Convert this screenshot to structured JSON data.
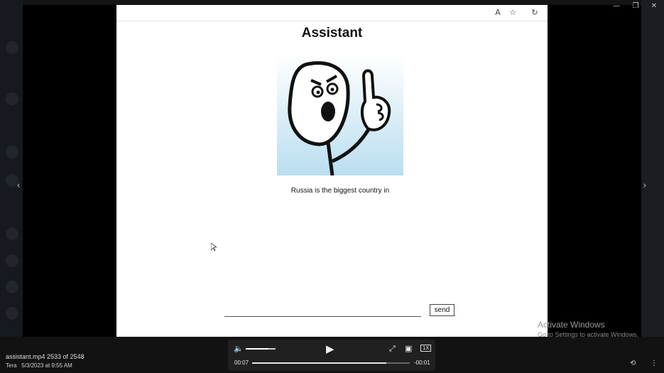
{
  "page": {
    "title": "Assistant",
    "message": "Russia is the biggest country in",
    "input": {
      "value": "",
      "placeholder": ""
    },
    "send_label": "send"
  },
  "watermark": {
    "line1": "Activate Windows",
    "line2": "Go to Settings to activate Windows."
  },
  "file": {
    "name_count": "assistant.mp4 2533 of 2548",
    "meta": "Tera   5/3/2023 at 9:55 AM"
  },
  "player": {
    "elapsed": "00:07",
    "remaining": "-00:01",
    "speed": "1X",
    "progress": 0.85,
    "volume": 0.75
  },
  "colors": {
    "accent": "#e6e6e6",
    "page_bg": "#ffffff",
    "viewer_bg": "#000000"
  },
  "icons": [
    "reader-mode-icon",
    "favorite-icon",
    "refresh-icon",
    "minimize-icon",
    "restore-icon",
    "close-icon",
    "previous-icon",
    "next-icon",
    "volume-icon",
    "play-icon",
    "fullscreen-icon",
    "picture-in-picture-icon",
    "rotate-icon",
    "more-options-icon"
  ]
}
